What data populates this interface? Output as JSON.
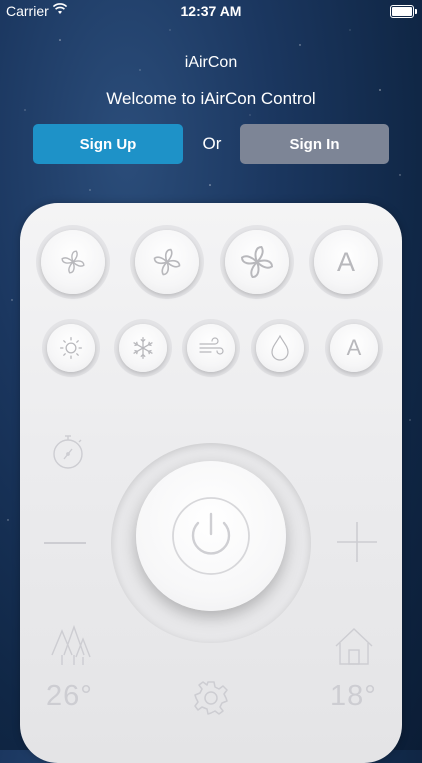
{
  "status_bar": {
    "carrier": "Carrier",
    "time": "12:37 AM"
  },
  "header": {
    "app_title": "iAirCon",
    "welcome": "Welcome to iAirCon Control"
  },
  "auth": {
    "signup_label": "Sign Up",
    "or_label": "Or",
    "signin_label": "Sign In"
  },
  "colors": {
    "signup_bg": "#1e92c8",
    "signin_bg": "#7d8596",
    "panel_bg": "#ececee",
    "icon_gray": "#b8b8bc"
  },
  "remote": {
    "fan_row": [
      {
        "icon": "fan-low-icon"
      },
      {
        "icon": "fan-medium-icon"
      },
      {
        "icon": "fan-high-icon"
      },
      {
        "icon": "fan-auto-icon",
        "label": "A"
      }
    ],
    "mode_row": [
      {
        "icon": "sun-icon"
      },
      {
        "icon": "snowflake-icon"
      },
      {
        "icon": "wind-icon"
      },
      {
        "icon": "water-drop-icon"
      },
      {
        "icon": "mode-auto-icon",
        "label": "A"
      }
    ],
    "outdoor_temp": "26°",
    "indoor_temp": "18°"
  }
}
